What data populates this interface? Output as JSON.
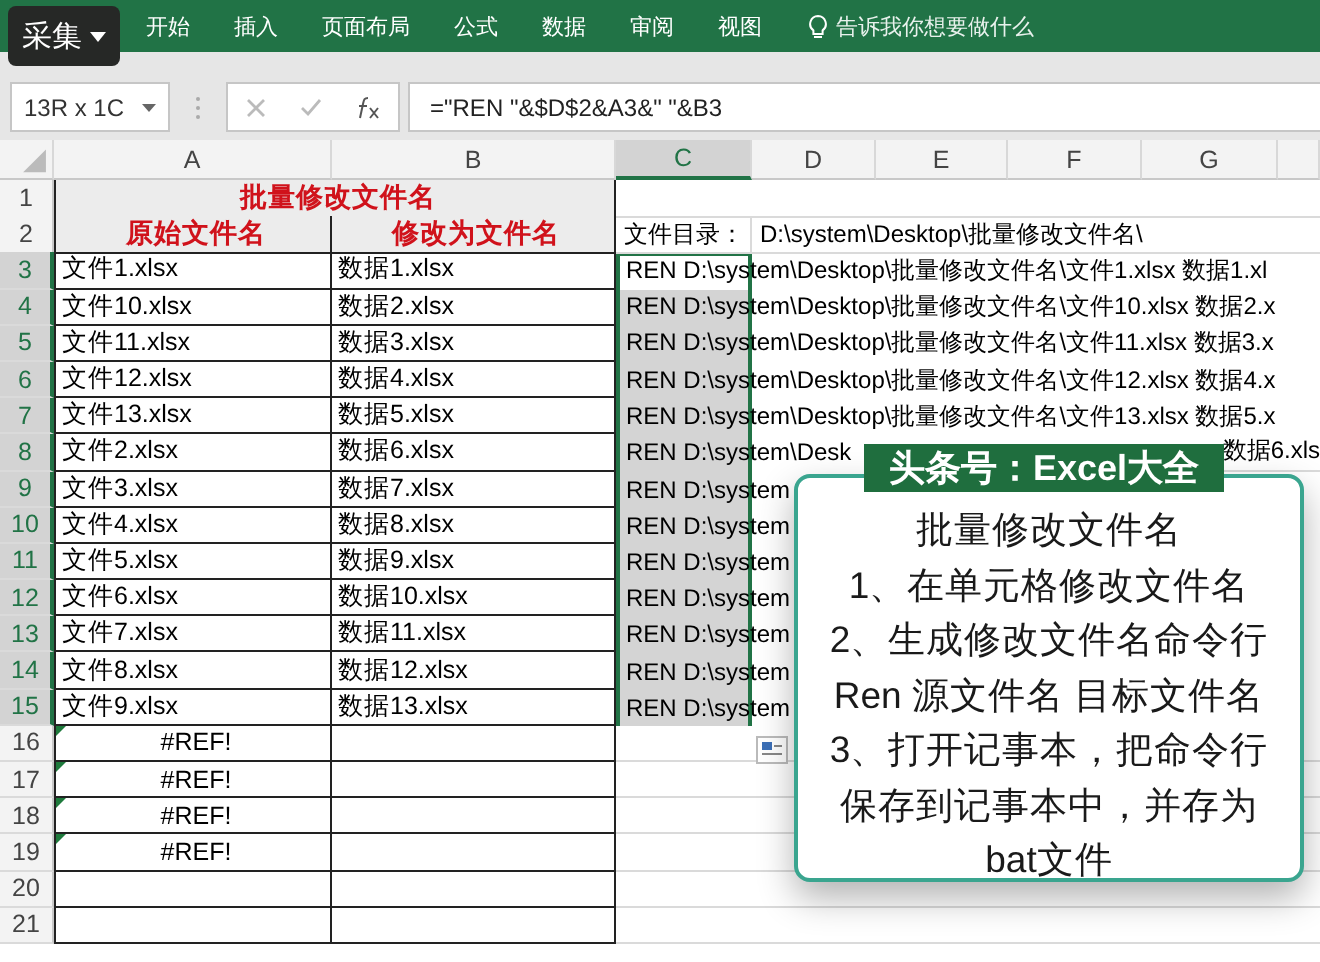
{
  "overlay_button": {
    "label": "采集"
  },
  "ribbon": {
    "tabs": [
      "开始",
      "插入",
      "页面布局",
      "公式",
      "数据",
      "审阅",
      "视图"
    ],
    "tell_me": "告诉我你想要做什么"
  },
  "formula_bar": {
    "name_box": "13R x 1C",
    "formula": "=\"REN \"&$D$2&A3&\" \"&B3"
  },
  "columns": [
    {
      "label": "A",
      "selected": false
    },
    {
      "label": "B",
      "selected": false
    },
    {
      "label": "C",
      "selected": true
    },
    {
      "label": "D",
      "selected": false
    },
    {
      "label": "E",
      "selected": false
    },
    {
      "label": "F",
      "selected": false
    },
    {
      "label": "G",
      "selected": false
    }
  ],
  "rows": [
    {
      "label": "1",
      "kind": "title",
      "selected": false,
      "text": "批量修改文件名"
    },
    {
      "label": "2",
      "kind": "header",
      "selected": false,
      "a": "原始文件名",
      "b": "修改为文件名",
      "c": "文件目录：",
      "d": "D:\\system\\Desktop\\批量修改文件名\\"
    },
    {
      "label": "3",
      "kind": "data",
      "selected": true,
      "shaded": false,
      "a": "文件1.xlsx",
      "b": "数据1.xlsx",
      "c": "REN D:\\system\\Desktop\\批量修改文件名\\文件1.xlsx 数据1.xl"
    },
    {
      "label": "4",
      "kind": "data",
      "selected": true,
      "shaded": true,
      "a": "文件10.xlsx",
      "b": "数据2.xlsx",
      "c": "REN D:\\system\\Desktop\\批量修改文件名\\文件10.xlsx 数据2.x"
    },
    {
      "label": "5",
      "kind": "data",
      "selected": true,
      "shaded": true,
      "a": "文件11.xlsx",
      "b": "数据3.xlsx",
      "c": "REN D:\\system\\Desktop\\批量修改文件名\\文件11.xlsx 数据3.x"
    },
    {
      "label": "6",
      "kind": "data",
      "selected": true,
      "shaded": true,
      "a": "文件12.xlsx",
      "b": "数据4.xlsx",
      "c": "REN D:\\system\\Desktop\\批量修改文件名\\文件12.xlsx 数据4.x"
    },
    {
      "label": "7",
      "kind": "data",
      "selected": true,
      "shaded": true,
      "a": "文件13.xlsx",
      "b": "数据5.xlsx",
      "c": "REN D:\\system\\Desktop\\批量修改文件名\\文件13.xlsx 数据5.x"
    },
    {
      "label": "8",
      "kind": "data",
      "selected": true,
      "shaded": true,
      "a": "文件2.xlsx",
      "b": "数据6.xlsx",
      "c": "REN D:\\system\\Desk",
      "tail": "数据6.xls"
    },
    {
      "label": "9",
      "kind": "data",
      "selected": true,
      "shaded": true,
      "a": "文件3.xlsx",
      "b": "数据7.xlsx",
      "c": "REN D:\\system"
    },
    {
      "label": "10",
      "kind": "data",
      "selected": true,
      "shaded": true,
      "a": "文件4.xlsx",
      "b": "数据8.xlsx",
      "c": "REN D:\\system"
    },
    {
      "label": "11",
      "kind": "data",
      "selected": true,
      "shaded": true,
      "a": "文件5.xlsx",
      "b": "数据9.xlsx",
      "c": "REN D:\\system"
    },
    {
      "label": "12",
      "kind": "data",
      "selected": true,
      "shaded": true,
      "a": "文件6.xlsx",
      "b": "数据10.xlsx",
      "c": "REN D:\\system"
    },
    {
      "label": "13",
      "kind": "data",
      "selected": true,
      "shaded": true,
      "a": "文件7.xlsx",
      "b": "数据11.xlsx",
      "c": "REN D:\\system"
    },
    {
      "label": "14",
      "kind": "data",
      "selected": true,
      "shaded": true,
      "a": "文件8.xlsx",
      "b": "数据12.xlsx",
      "c": "REN D:\\system"
    },
    {
      "label": "15",
      "kind": "data",
      "selected": true,
      "shaded": true,
      "a": "文件9.xlsx",
      "b": "数据13.xlsx",
      "c": "REN D:\\system"
    },
    {
      "label": "16",
      "kind": "error",
      "selected": false,
      "a": "#REF!",
      "flag": true
    },
    {
      "label": "17",
      "kind": "error",
      "selected": false,
      "a": "#REF!",
      "flag": true
    },
    {
      "label": "18",
      "kind": "error",
      "selected": false,
      "a": "#REF!",
      "flag": true
    },
    {
      "label": "19",
      "kind": "error",
      "selected": false,
      "a": "#REF!",
      "flag": true
    },
    {
      "label": "20",
      "kind": "empty",
      "selected": false
    },
    {
      "label": "21",
      "kind": "empty",
      "selected": false
    }
  ],
  "note": {
    "badge": "头条号：Excel大全",
    "lines": [
      "批量修改文件名",
      "1、在单元格修改文件名",
      "2、生成修改文件名命令行",
      "Ren 源文件名 目标文件名",
      "3、打开记事本，把命令行",
      "保存到记事本中，并存为",
      "bat文件"
    ]
  }
}
